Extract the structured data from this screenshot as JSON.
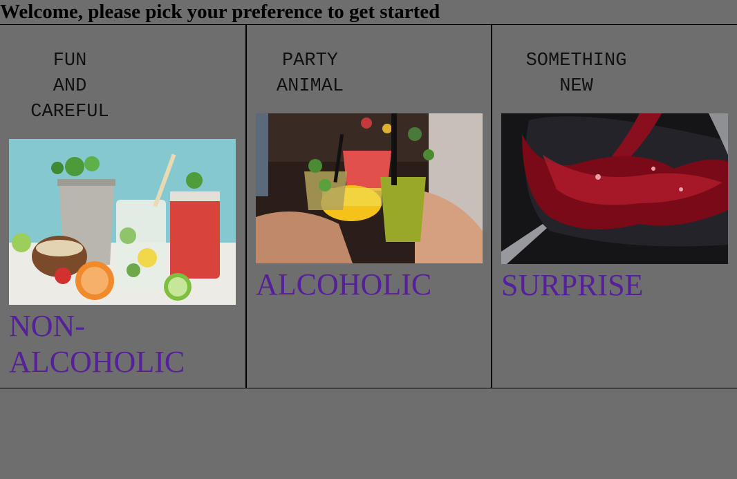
{
  "header": {
    "title": "Welcome, please pick your preference to get started"
  },
  "options": [
    {
      "tagline": [
        "FUN",
        "AND",
        "CAREFUL"
      ],
      "label": "NON-ALCOHOLIC",
      "image": "mocktails-photo"
    },
    {
      "tagline": [
        "PARTY",
        "ANIMAL"
      ],
      "label": "ALCOHOLIC",
      "image": "cocktails-toast-photo"
    },
    {
      "tagline": [
        "SOMETHING",
        "NEW"
      ],
      "label": "SURPRISE",
      "image": "red-wine-photo"
    }
  ],
  "colors": {
    "background": "#6e6e6e",
    "label": "#55209a",
    "border": "#000000"
  }
}
